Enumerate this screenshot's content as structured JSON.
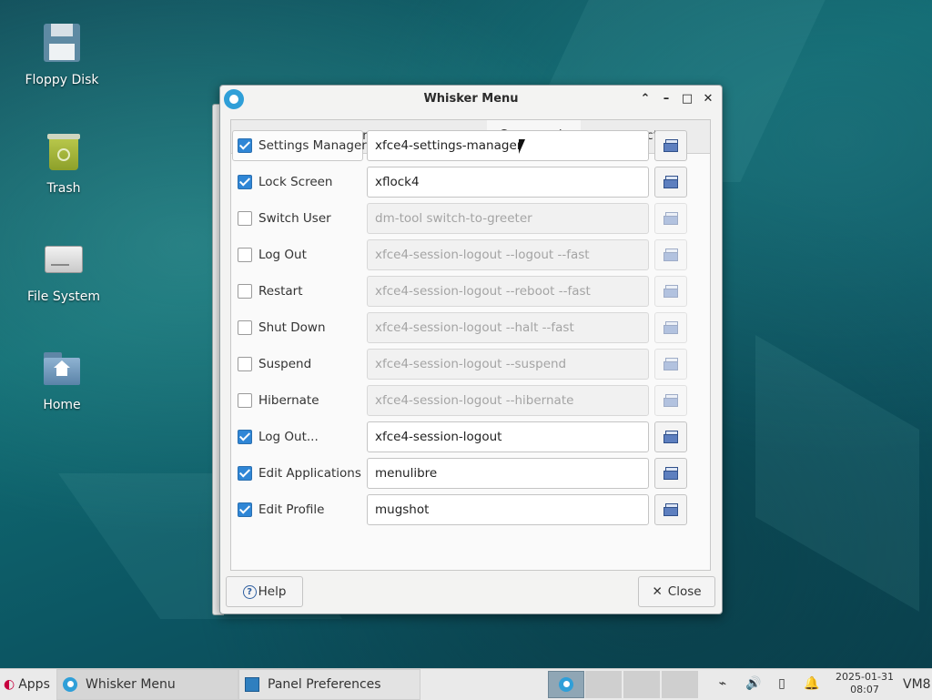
{
  "desktop": {
    "icons": [
      {
        "label": "Floppy Disk"
      },
      {
        "label": "Trash"
      },
      {
        "label": "File System"
      },
      {
        "label": "Home"
      }
    ]
  },
  "window": {
    "title": "Whisker Menu",
    "controls": {
      "shade": "⌃",
      "minimize": "–",
      "maximize": "□",
      "close": "✕"
    },
    "tabs": [
      {
        "label": "General",
        "active": false
      },
      {
        "label": "Appearance",
        "active": false
      },
      {
        "label": "Behavior",
        "active": false
      },
      {
        "label": "Commands",
        "active": true
      },
      {
        "label": "Search Actions",
        "active": false
      }
    ],
    "commands": [
      {
        "label": "Settings Manager",
        "checked": true,
        "command": "xfce4-settings-manager"
      },
      {
        "label": "Lock Screen",
        "checked": true,
        "command": "xflock4"
      },
      {
        "label": "Switch User",
        "checked": false,
        "command": "dm-tool switch-to-greeter"
      },
      {
        "label": "Log Out",
        "checked": false,
        "command": "xfce4-session-logout --logout --fast"
      },
      {
        "label": "Restart",
        "checked": false,
        "command": "xfce4-session-logout --reboot --fast"
      },
      {
        "label": "Shut Down",
        "checked": false,
        "command": "xfce4-session-logout --halt --fast"
      },
      {
        "label": "Suspend",
        "checked": false,
        "command": "xfce4-session-logout --suspend"
      },
      {
        "label": "Hibernate",
        "checked": false,
        "command": "xfce4-session-logout --hibernate"
      },
      {
        "label": "Log Out...",
        "checked": true,
        "command": "xfce4-session-logout"
      },
      {
        "label": "Edit Applications",
        "checked": true,
        "command": "menulibre"
      },
      {
        "label": "Edit Profile",
        "checked": true,
        "command": "mugshot"
      }
    ],
    "help_label": "Help",
    "close_label": "Close",
    "help_glyph": "?",
    "close_glyph": "✕"
  },
  "taskbar": {
    "apps_label": "Apps",
    "tasks": [
      {
        "label": "Whisker Menu",
        "active": true
      },
      {
        "label": "Panel Preferences",
        "active": false
      }
    ],
    "clock_date": "2025-01-31",
    "clock_time": "08:07",
    "host_label": "VM8"
  },
  "colors": {
    "accent": "#2f86d6",
    "desktop_teal": "#0f6b72"
  }
}
